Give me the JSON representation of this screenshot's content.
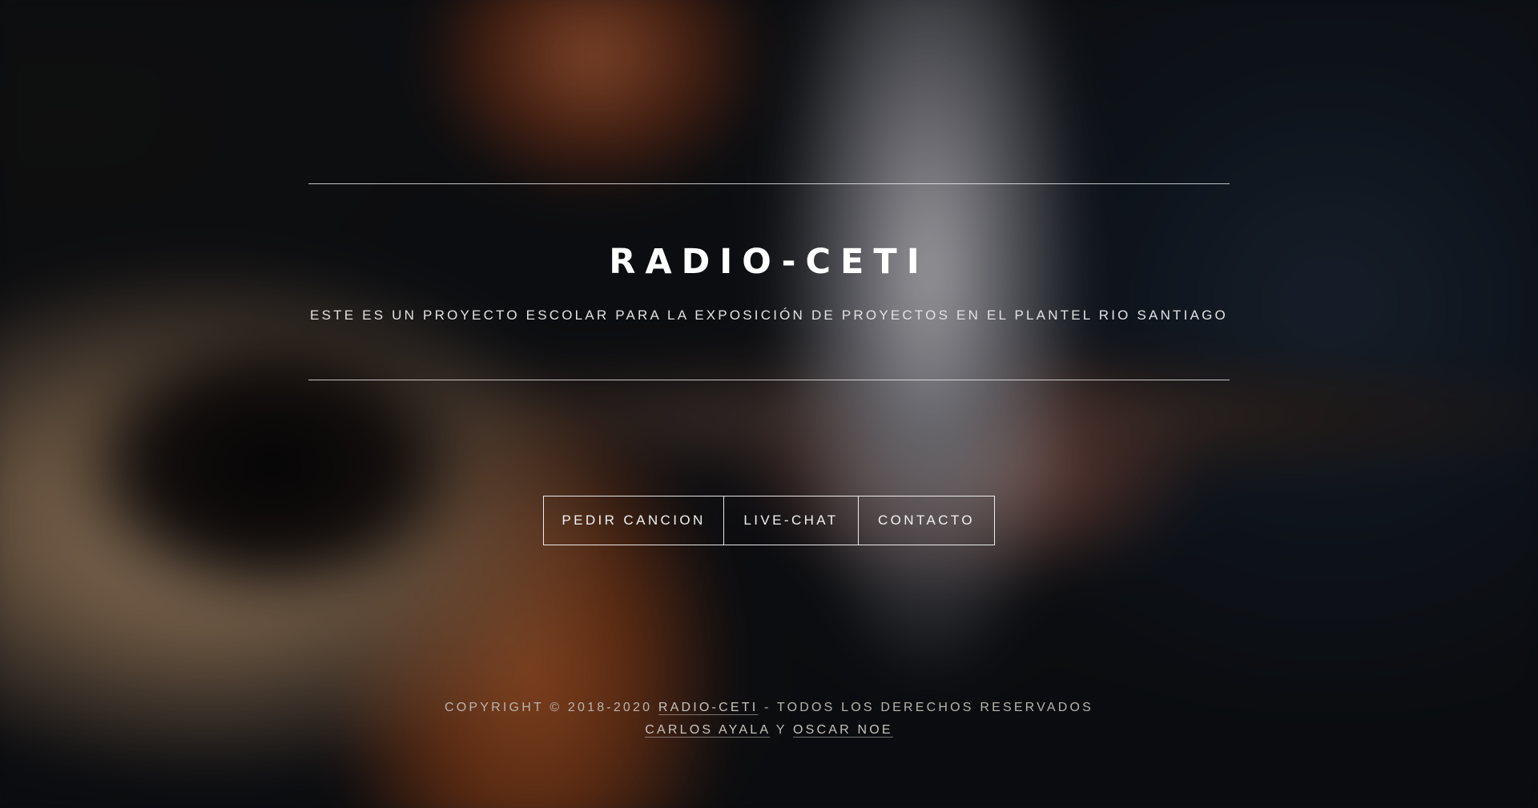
{
  "site": {
    "title": "RADIO-CETI",
    "subtitle": "ESTE ES UN PROYECTO ESCOLAR PARA LA EXPOSICIÓN DE PROYECTOS EN EL PLANTEL RIO SANTIAGO"
  },
  "nav": {
    "buttons": [
      {
        "label": "PEDIR CANCION"
      },
      {
        "label": "LIVE-CHAT"
      },
      {
        "label": "CONTACTO"
      }
    ]
  },
  "footer": {
    "copyright_prefix": "COPYRIGHT © 2018-2020",
    "site_link": "RADIO-CETI",
    "copyright_suffix": "- TODOS LOS DERECHOS RESERVADOS",
    "author1": "CARLOS AYALA",
    "conjunction": "Y",
    "author2": "OSCAR NOE"
  },
  "background": {
    "description_icon": "blurred-guitar-photo"
  }
}
